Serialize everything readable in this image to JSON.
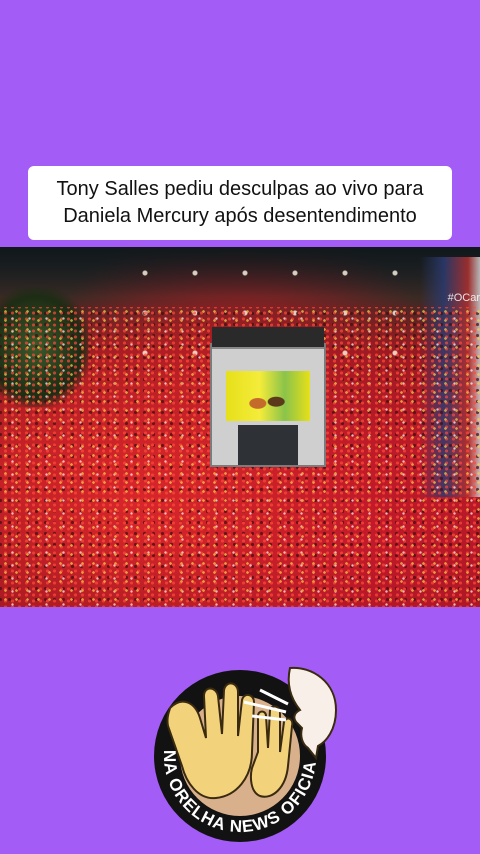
{
  "caption": {
    "line1": "Tony Salles pediu desculpas ao vivo para",
    "line2": "Daniela Mercury após desentendimento"
  },
  "video": {
    "watermark": "#OCar"
  },
  "logo": {
    "text": "NA ORELHA NEWS OFICIAL"
  },
  "colors": {
    "background": "#a35cf6",
    "caption_bg": "#ffffff",
    "logo_ring": "#121212",
    "logo_inner": "#d8b08c"
  }
}
